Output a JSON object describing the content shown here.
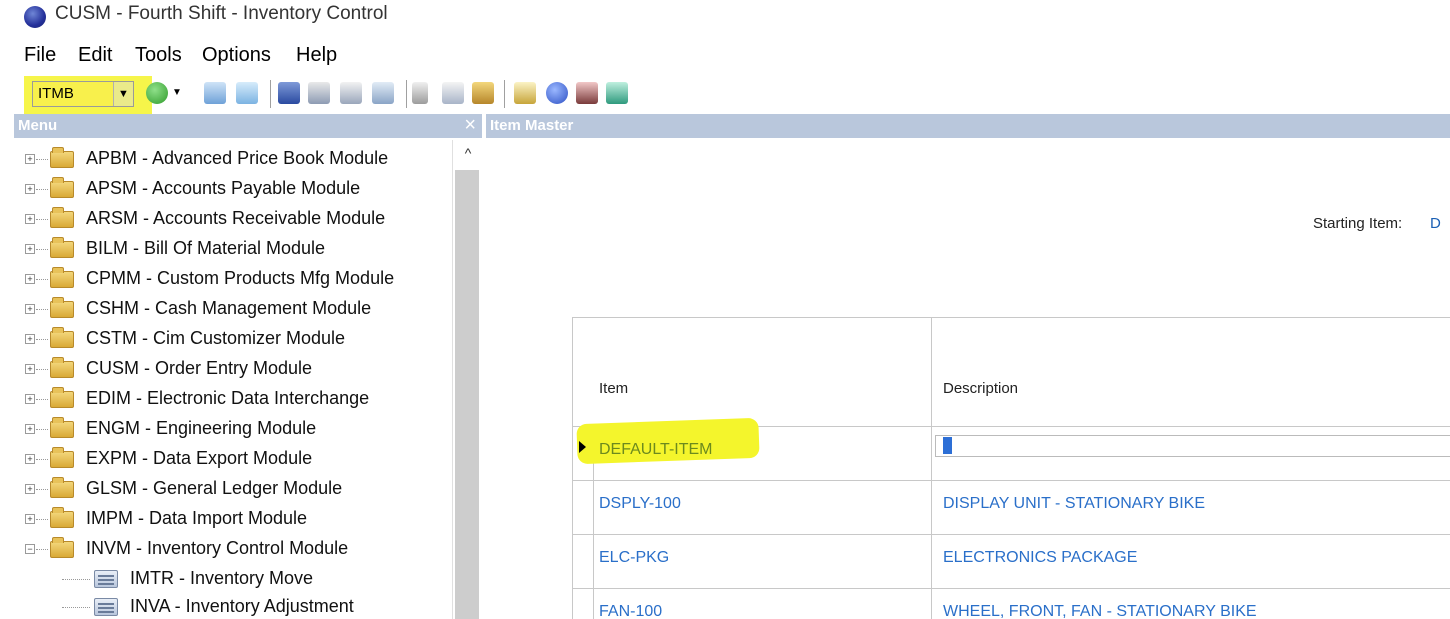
{
  "window": {
    "title": "CUSM - Fourth Shift - Inventory Control"
  },
  "menubar": {
    "items": [
      "File",
      "Edit",
      "Tools",
      "Options",
      "Help"
    ]
  },
  "toolbar": {
    "combo_value": "ITMB",
    "icons": [
      "go-forward-icon",
      "dropdown-arrow-icon",
      "find-icon",
      "back-icon",
      "save-icon",
      "print-icon",
      "preview-icon",
      "layout-icon",
      "cut-icon",
      "copy-icon",
      "paste-icon",
      "form-icon",
      "help-icon",
      "hand-icon",
      "book-icon"
    ],
    "colors": {
      "highlight": "#f6f54a"
    }
  },
  "menu_panel": {
    "title": "Menu",
    "close": "×",
    "items": [
      {
        "label": "APBM - Advanced Price Book Module",
        "toggle": "+"
      },
      {
        "label": "APSM - Accounts Payable Module",
        "toggle": "+"
      },
      {
        "label": "ARSM - Accounts Receivable Module",
        "toggle": "+"
      },
      {
        "label": "BILM - Bill Of Material Module",
        "toggle": "+"
      },
      {
        "label": "CPMM - Custom Products Mfg Module",
        "toggle": "+"
      },
      {
        "label": "CSHM - Cash Management Module",
        "toggle": "+"
      },
      {
        "label": "CSTM - Cim Customizer Module",
        "toggle": "+"
      },
      {
        "label": "CUSM - Order Entry Module",
        "toggle": "+"
      },
      {
        "label": "EDIM - Electronic Data Interchange",
        "toggle": "+"
      },
      {
        "label": "ENGM - Engineering Module",
        "toggle": "+"
      },
      {
        "label": "EXPM - Data Export Module",
        "toggle": "+"
      },
      {
        "label": "GLSM - General Ledger Module",
        "toggle": "+"
      },
      {
        "label": "IMPM - Data Import Module",
        "toggle": "+"
      },
      {
        "label": "INVM - Inventory Control Module",
        "toggle": "−"
      }
    ],
    "children": [
      {
        "label": "IMTR - Inventory Move"
      },
      {
        "label": "INVA - Inventory Adjustment"
      }
    ],
    "scroll_up": "^"
  },
  "item_master": {
    "title": "Item Master",
    "starting_item_label": "Starting Item:",
    "starting_item_value": "D",
    "columns": [
      "Item",
      "Description"
    ],
    "rows": [
      {
        "item": "DEFAULT-ITEM",
        "description": ""
      },
      {
        "item": "DSPLY-100",
        "description": "DISPLAY UNIT - STATIONARY BIKE"
      },
      {
        "item": "ELC-PKG",
        "description": "ELECTRONICS PACKAGE"
      },
      {
        "item": "FAN-100",
        "description": "WHEEL, FRONT, FAN - STATIONARY BIKE"
      }
    ],
    "colors": {
      "link": "#2a6fc9",
      "highlight": "#f4f52c"
    }
  }
}
